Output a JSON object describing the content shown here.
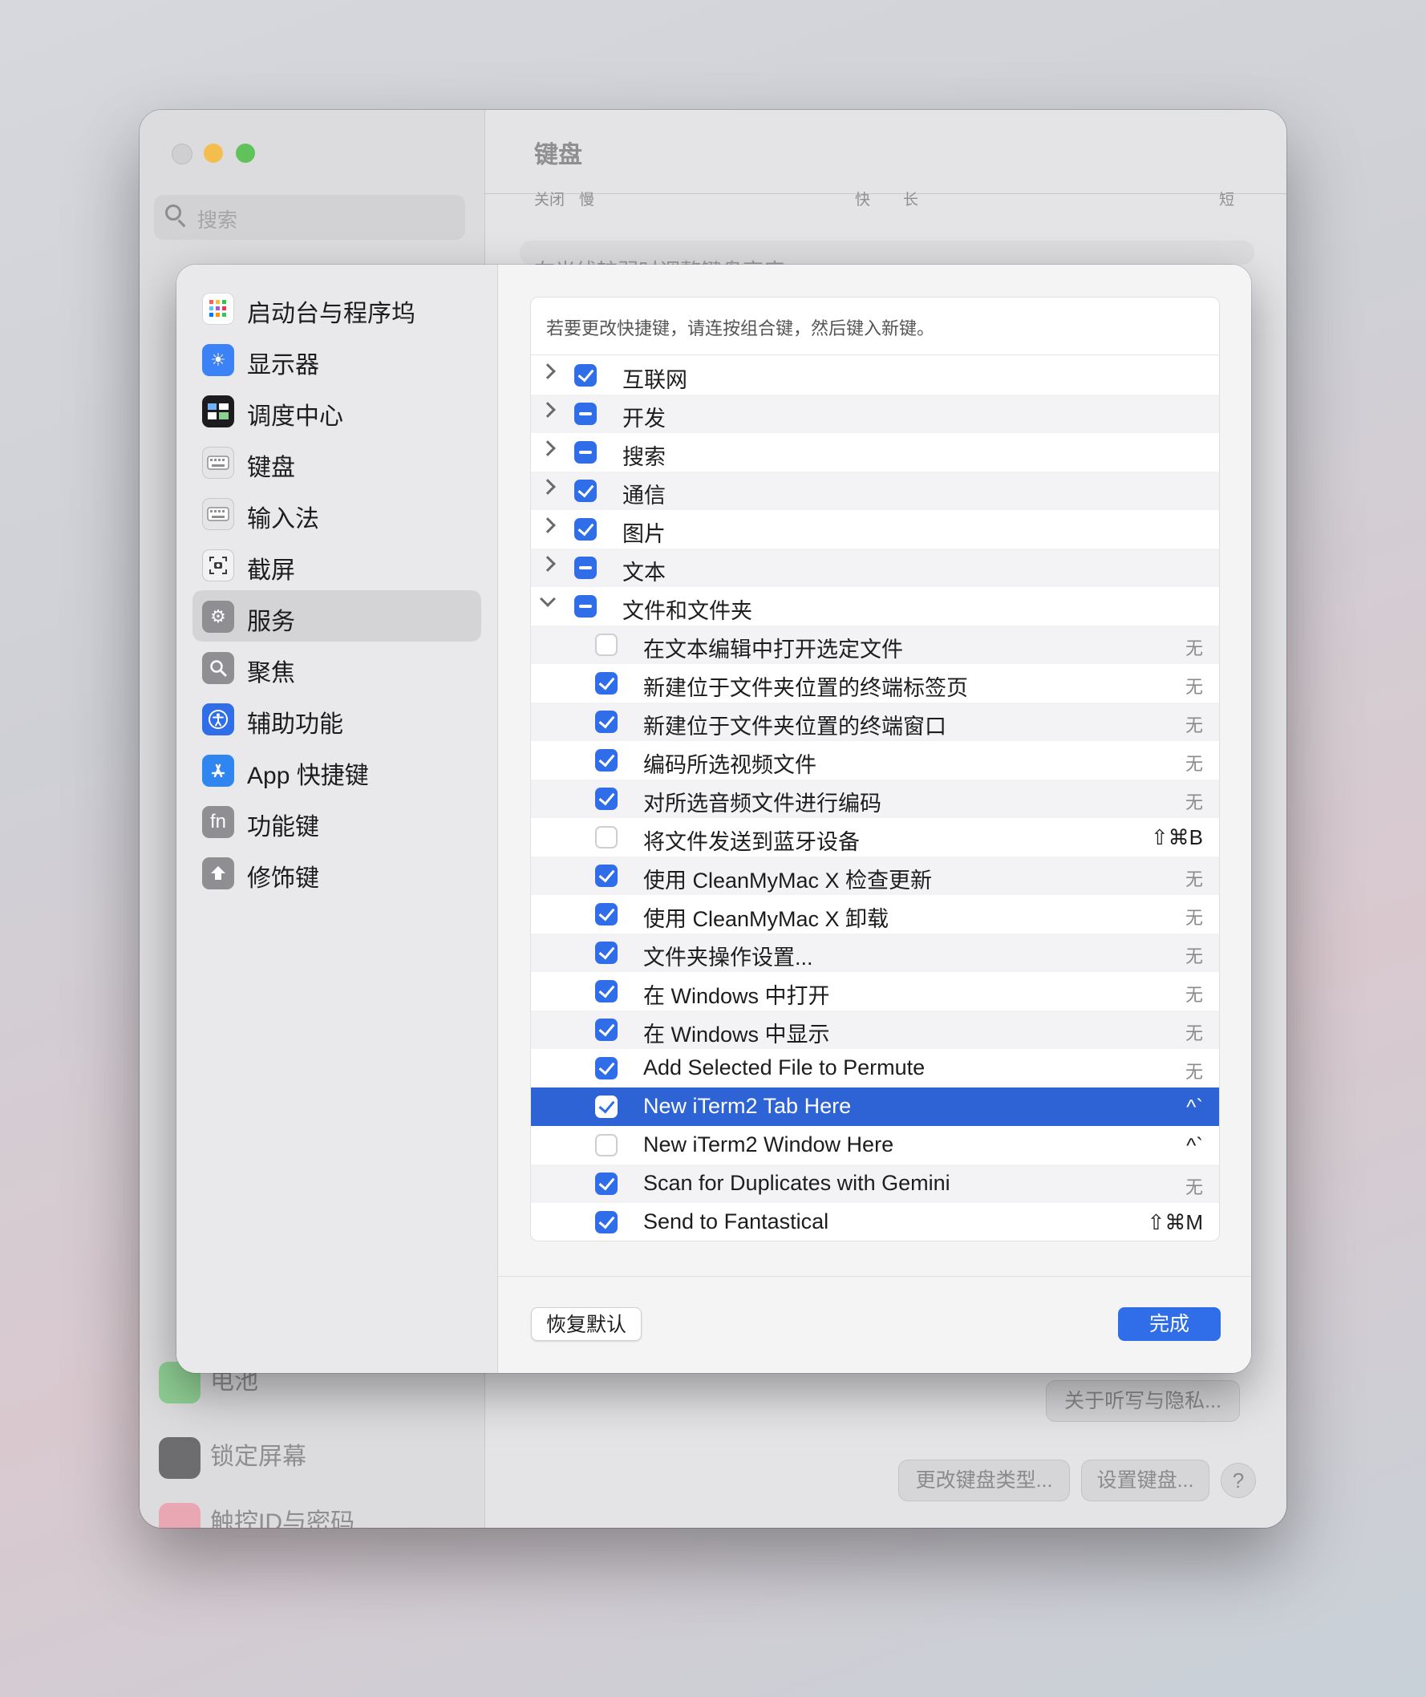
{
  "background_window": {
    "title": "键盘",
    "search_placeholder": "搜索",
    "scale_labels": [
      "关闭",
      "慢",
      "快",
      "长",
      "短"
    ],
    "setting_partial": "在光线较弱时调整键盘亮度",
    "sidebar_items": [
      {
        "label": "电池",
        "icon": "battery-icon",
        "color": "#5cc163"
      },
      {
        "label": "锁定屏幕",
        "icon": "lock-icon",
        "color": "#3a3a3c"
      },
      {
        "label": "触控ID与密码",
        "icon": "fingerprint-icon",
        "color": "#ef4f6b"
      }
    ],
    "buttons": {
      "dictation_privacy": "关于听写与隐私...",
      "change_keyboard_type": "更改键盘类型...",
      "set_up_keyboard": "设置键盘...",
      "help": "?"
    }
  },
  "sheet": {
    "sidebar": [
      {
        "label": "启动台与程序坞",
        "icon": "launchpad-icon",
        "color": "#ffffff",
        "selected": false
      },
      {
        "label": "显示器",
        "icon": "display-icon",
        "color": "#3b82f6",
        "selected": false
      },
      {
        "label": "调度中心",
        "icon": "mission-control-icon",
        "color": "#1c1c1e",
        "selected": false
      },
      {
        "label": "键盘",
        "icon": "keyboard-icon",
        "color": "#e5e5e8",
        "selected": false
      },
      {
        "label": "输入法",
        "icon": "input-source-icon",
        "color": "#e5e5e8",
        "selected": false
      },
      {
        "label": "截屏",
        "icon": "screenshot-icon",
        "color": "#f2f2f4",
        "selected": false
      },
      {
        "label": "服务",
        "icon": "services-icon",
        "color": "#8e8e93",
        "selected": true
      },
      {
        "label": "聚焦",
        "icon": "spotlight-icon",
        "color": "#8e8e93",
        "selected": false
      },
      {
        "label": "辅助功能",
        "icon": "accessibility-icon",
        "color": "#2f6ee8",
        "selected": false
      },
      {
        "label": "App 快捷键",
        "icon": "app-store-icon",
        "color": "#2f86f0",
        "selected": false
      },
      {
        "label": "功能键",
        "icon": "fn-key-icon",
        "color": "#8e8e93",
        "selected": false
      },
      {
        "label": "修饰键",
        "icon": "modifier-key-icon",
        "color": "#8e8e93",
        "selected": false
      }
    ],
    "hint": "若要更改快捷键，请连按组合键，然后键入新键。",
    "categories": [
      {
        "label": "互联网",
        "state": "on",
        "expanded": false
      },
      {
        "label": "开发",
        "state": "mixed",
        "expanded": false
      },
      {
        "label": "搜索",
        "state": "mixed",
        "expanded": false
      },
      {
        "label": "通信",
        "state": "on",
        "expanded": false
      },
      {
        "label": "图片",
        "state": "on",
        "expanded": false
      },
      {
        "label": "文本",
        "state": "mixed",
        "expanded": false
      },
      {
        "label": "文件和文件夹",
        "state": "mixed",
        "expanded": true
      }
    ],
    "services": [
      {
        "label": "在文本编辑中打开选定文件",
        "checked": false,
        "shortcut": "无",
        "selected": false
      },
      {
        "label": "新建位于文件夹位置的终端标签页",
        "checked": true,
        "shortcut": "无",
        "selected": false
      },
      {
        "label": "新建位于文件夹位置的终端窗口",
        "checked": true,
        "shortcut": "无",
        "selected": false
      },
      {
        "label": "编码所选视频文件",
        "checked": true,
        "shortcut": "无",
        "selected": false
      },
      {
        "label": "对所选音频文件进行编码",
        "checked": true,
        "shortcut": "无",
        "selected": false
      },
      {
        "label": "将文件发送到蓝牙设备",
        "checked": false,
        "shortcut": "⇧⌘B",
        "selected": false
      },
      {
        "label": "使用 CleanMyMac X 检查更新",
        "checked": true,
        "shortcut": "无",
        "selected": false
      },
      {
        "label": "使用 CleanMyMac X 卸载",
        "checked": true,
        "shortcut": "无",
        "selected": false
      },
      {
        "label": "文件夹操作设置...",
        "checked": true,
        "shortcut": "无",
        "selected": false
      },
      {
        "label": "在 Windows 中打开",
        "checked": true,
        "shortcut": "无",
        "selected": false
      },
      {
        "label": "在 Windows 中显示",
        "checked": true,
        "shortcut": "无",
        "selected": false
      },
      {
        "label": "Add Selected File to Permute",
        "checked": true,
        "shortcut": "无",
        "selected": false
      },
      {
        "label": "New iTerm2 Tab Here",
        "checked": true,
        "shortcut": "^`",
        "selected": true
      },
      {
        "label": "New iTerm2 Window Here",
        "checked": false,
        "shortcut": "^`",
        "selected": false
      },
      {
        "label": "Scan for Duplicates with Gemini",
        "checked": true,
        "shortcut": "无",
        "selected": false
      },
      {
        "label": "Send to Fantastical",
        "checked": true,
        "shortcut": "⇧⌘M",
        "selected": false
      }
    ],
    "buttons": {
      "restore_defaults": "恢复默认",
      "done": "完成"
    },
    "accent_color": "#2f6ee8",
    "selection_color": "#2e63d6"
  }
}
